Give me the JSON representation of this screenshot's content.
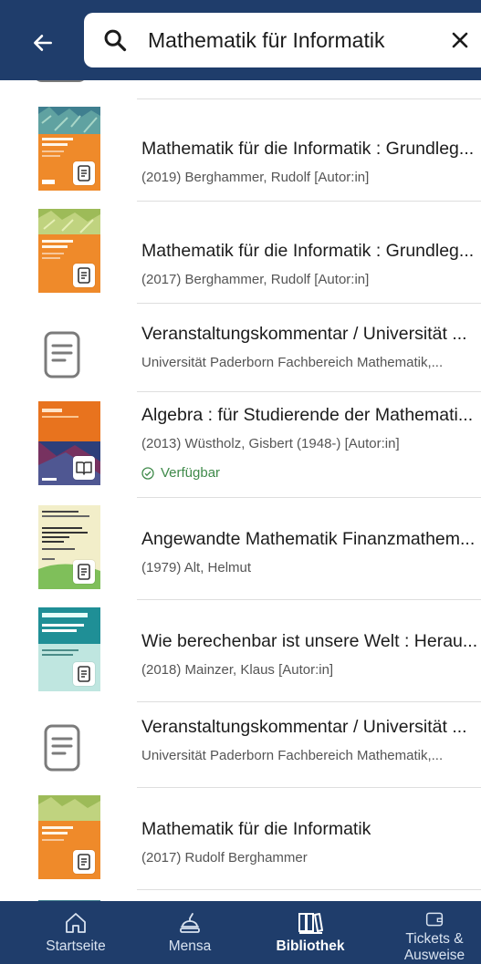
{
  "search": {
    "value": "Mathematik für Informatik"
  },
  "results": [
    {
      "title": "Mathematik für die Informatik : Grundleg...",
      "subtitle": "(2019) Berghammer, Rudolf [Autor:in]",
      "thumb": "cover-springer-orange",
      "badge": "document-icon"
    },
    {
      "title": "Mathematik für die Informatik : Grundleg...",
      "subtitle": "(2017) Berghammer, Rudolf [Autor:in]",
      "thumb": "cover-springer-orange",
      "badge": "document-icon"
    },
    {
      "title": "Veranstaltungskommentar / Universität ...",
      "subtitle": "Universität Paderborn Fachbereich Mathematik,...",
      "thumb": "document-icon"
    },
    {
      "title": "Algebra : für Studierende der Mathemati...",
      "subtitle": "(2013) Wüstholz, Gisbert (1948-) [Autor:in]",
      "availability": "Verfügbar",
      "thumb": "cover-algebra",
      "badge": "book-icon"
    },
    {
      "title": "Angewandte Mathematik Finanzmathem...",
      "subtitle": "(1979) Alt, Helmut",
      "thumb": "cover-angewandte",
      "badge": "document-icon"
    },
    {
      "title": "Wie berechenbar ist unsere Welt : Herau...",
      "subtitle": "(2018) Mainzer, Klaus [Autor:in]",
      "thumb": "cover-essentials",
      "badge": "document-icon"
    },
    {
      "title": "Veranstaltungskommentar / Universität ...",
      "subtitle": "Universität Paderborn Fachbereich Mathematik,...",
      "thumb": "document-icon"
    },
    {
      "title": "Mathematik für die Informatik",
      "subtitle": "(2017) Rudolf Berghammer",
      "thumb": "cover-springer-orange",
      "badge": "document-icon"
    }
  ],
  "nav": {
    "items": [
      {
        "label": "Startseite",
        "icon": "home-icon"
      },
      {
        "label": "Mensa",
        "icon": "mensa-icon"
      },
      {
        "label": "Bibliothek",
        "icon": "library-icon",
        "active": true
      },
      {
        "label": "Tickets & Ausweise",
        "icon": "wallet-icon"
      }
    ]
  },
  "colors": {
    "primary": "#1f3d6b",
    "available": "#3f8a4a",
    "springer_orange": "#e8731e"
  }
}
